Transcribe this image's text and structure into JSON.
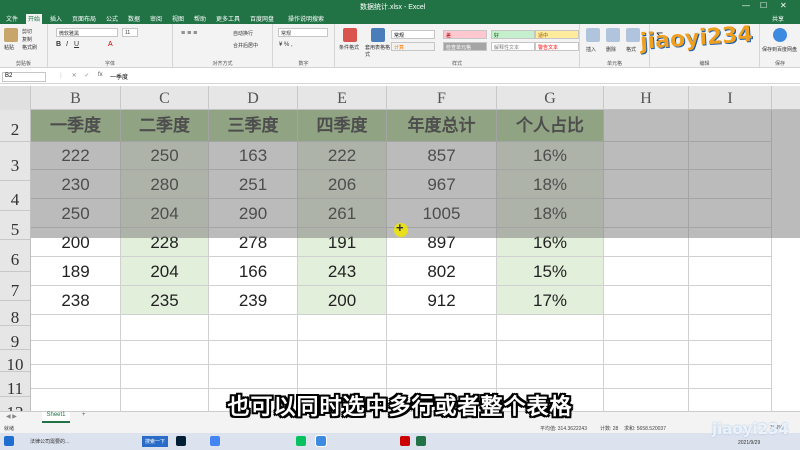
{
  "app": {
    "title": "数据统计.xlsx - Excel",
    "share": "共享"
  },
  "tabs": [
    "文件",
    "开始",
    "插入",
    "页面布局",
    "公式",
    "数据",
    "审阅",
    "视图",
    "帮助",
    "更多工具",
    "百度网盘",
    "操作说明搜索"
  ],
  "active_tab": "开始",
  "ribbon": {
    "clipboard": {
      "paste": "粘贴",
      "cut": "剪切",
      "copy": "复制",
      "format_painter": "格式刷",
      "label": "剪贴板"
    },
    "font": {
      "name": "微软雅黑",
      "size": "11",
      "label": "字体"
    },
    "align": {
      "wrap": "自动换行",
      "merge": "合并后居中",
      "label": "对齐方式"
    },
    "number": {
      "format": "常规",
      "label": "数字"
    },
    "styles": {
      "cond": "条件格式",
      "table": "套用表格格式",
      "label": "样式",
      "cells": [
        {
          "text": "常规",
          "bg": "#ffffff",
          "color": "#000000"
        },
        {
          "text": "差",
          "bg": "#ffc7ce",
          "color": "#9c0006"
        },
        {
          "text": "好",
          "bg": "#c6efce",
          "color": "#006100"
        },
        {
          "text": "适中",
          "bg": "#ffeb9c",
          "color": "#9c5700"
        },
        {
          "text": "计算",
          "bg": "#f2f2f2",
          "color": "#fa7d00"
        },
        {
          "text": "检查单元格",
          "bg": "#a5a5a5",
          "color": "#ffffff"
        },
        {
          "text": "解释性文本",
          "bg": "#ffffff",
          "color": "#7f7f7f"
        },
        {
          "text": "警告文本",
          "bg": "#ffffff",
          "color": "#ff0000"
        }
      ]
    },
    "cells_group": {
      "insert": "插入",
      "delete": "删除",
      "format": "格式",
      "label": "单元格"
    },
    "editing": {
      "label": "编辑",
      "sort": "排序和筛选",
      "find": "查找和选择"
    },
    "save": {
      "label": "保存",
      "baidu": "保存到百度网盘"
    }
  },
  "formula_bar": {
    "name_box": "B2",
    "fx": "fx",
    "content": "一季度"
  },
  "columns": [
    "B",
    "C",
    "D",
    "E",
    "F",
    "G",
    "H",
    "I"
  ],
  "rows": [
    "2",
    "3",
    "4",
    "5",
    "6",
    "7",
    "8",
    "9",
    "10",
    "11",
    "12"
  ],
  "table": {
    "headers": [
      "一季度",
      "二季度",
      "三季度",
      "四季度",
      "年度总计",
      "个人占比"
    ],
    "data": [
      [
        "222",
        "250",
        "163",
        "222",
        "857",
        "16%"
      ],
      [
        "230",
        "280",
        "251",
        "206",
        "967",
        "18%"
      ],
      [
        "250",
        "204",
        "290",
        "261",
        "1005",
        "18%"
      ],
      [
        "200",
        "228",
        "278",
        "191",
        "897",
        "16%"
      ],
      [
        "189",
        "204",
        "166",
        "243",
        "802",
        "15%"
      ],
      [
        "238",
        "235",
        "239",
        "200",
        "912",
        "17%"
      ]
    ]
  },
  "sheet": {
    "name": "Sheet1",
    "add": "+"
  },
  "status": {
    "mode": "就绪",
    "average": "平均值: 314.3622243",
    "count": "计数: 28",
    "sum": "求和: 5658.520037",
    "zoom": "100%"
  },
  "taskbar": {
    "search": "搜索一下",
    "item": "法律公司需要的...",
    "date": "2021/9/29"
  },
  "subtitle": "也可以同时选中多行或者整个表格",
  "watermark": "jiaoyi234",
  "colors": {
    "accent": "#217346",
    "header_green": "#a9d08e",
    "light_green": "#e2efda"
  }
}
